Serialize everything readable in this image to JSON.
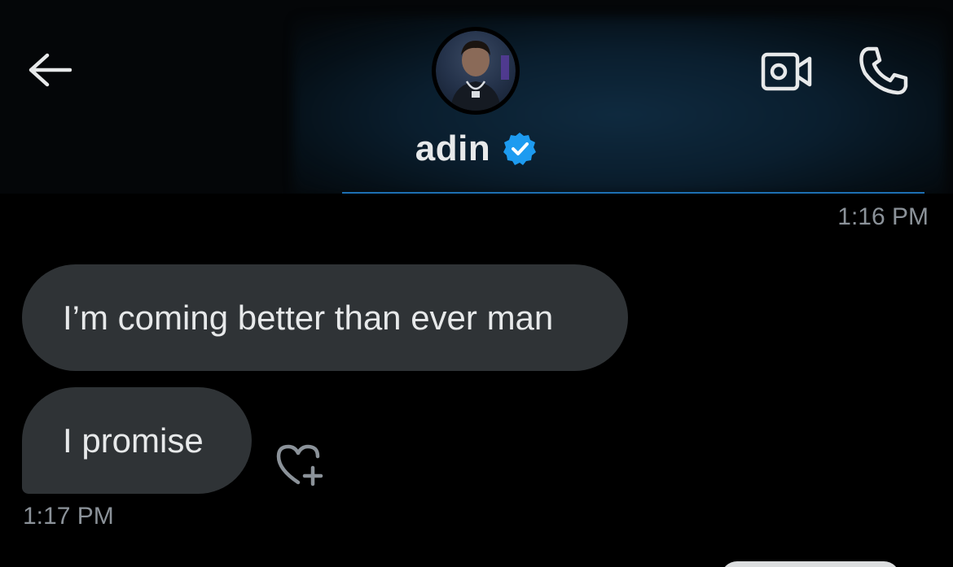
{
  "header": {
    "contact_name": "adin",
    "verified": true,
    "icons": {
      "back": "arrow-left-icon",
      "video": "video-camera-icon",
      "phone": "phone-icon",
      "verified": "verified-badge-icon"
    },
    "accent_color": "#1d9bf0"
  },
  "messages": [
    {
      "type": "timestamp",
      "text": "1:16 PM"
    },
    {
      "type": "received",
      "text": "I’m coming better than ever man"
    },
    {
      "type": "received",
      "text": "I promise"
    },
    {
      "type": "timestamp",
      "text": "1:17 PM"
    }
  ],
  "colors": {
    "background": "#000000",
    "bubble": "#2f3336",
    "text": "#e7e9ea",
    "muted": "#8b9299"
  },
  "reaction_icon": "heart-add-icon"
}
